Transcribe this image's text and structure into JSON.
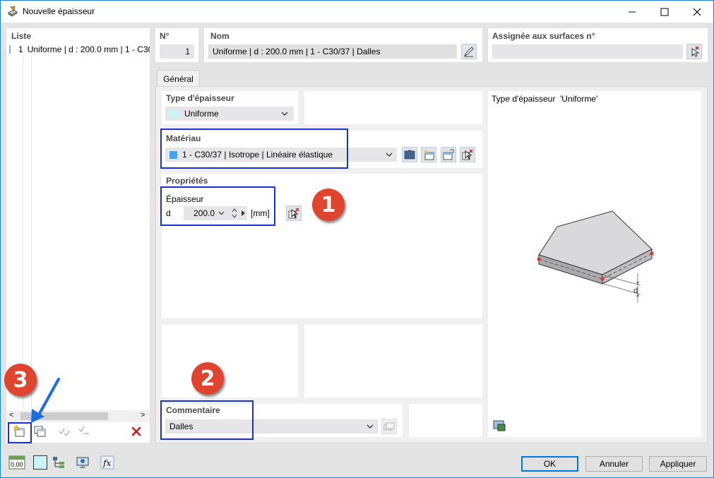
{
  "window": {
    "title": "Nouvelle épaisseur"
  },
  "list": {
    "header": "Liste",
    "items": [
      {
        "num": "1",
        "label": "Uniforme | d : 200.0 mm | 1 - C30"
      }
    ]
  },
  "top": {
    "no_label": "N°",
    "no_value": "1",
    "name_label": "Nom",
    "name_value": "Uniforme | d : 200.0 mm | 1 - C30/37 | Dalles",
    "assigned_label": "Assignée aux surfaces n°",
    "assigned_value": ""
  },
  "tabs": [
    {
      "label": "Général"
    }
  ],
  "type": {
    "label": "Type d'épaisseur",
    "value": "Uniforme",
    "swatch_color": "#cdf2f6"
  },
  "material": {
    "label": "Matériau",
    "value": "1 - C30/37 | Isotrope | Linéaire élastique",
    "swatch_color": "#4aa3e8"
  },
  "properties": {
    "label": "Propriétés",
    "thickness_label": "Épaisseur",
    "symbol": "d",
    "value": "200.0",
    "unit": "[mm]"
  },
  "preview": {
    "caption": "Type d'épaisseur  'Uniforme'",
    "dim_label": "d"
  },
  "comment": {
    "label": "Commentaire",
    "value": "Dalles"
  },
  "badges": {
    "one": "1",
    "two": "2",
    "three": "3"
  },
  "buttons": {
    "ok": "OK",
    "cancel": "Annuler",
    "apply": "Appliquer"
  },
  "statusbar": {
    "units_icon_text": "0.00"
  },
  "colors": {
    "highlight": "#1a2fd8",
    "badge": "#e0432e",
    "accent": "#1883d7"
  }
}
